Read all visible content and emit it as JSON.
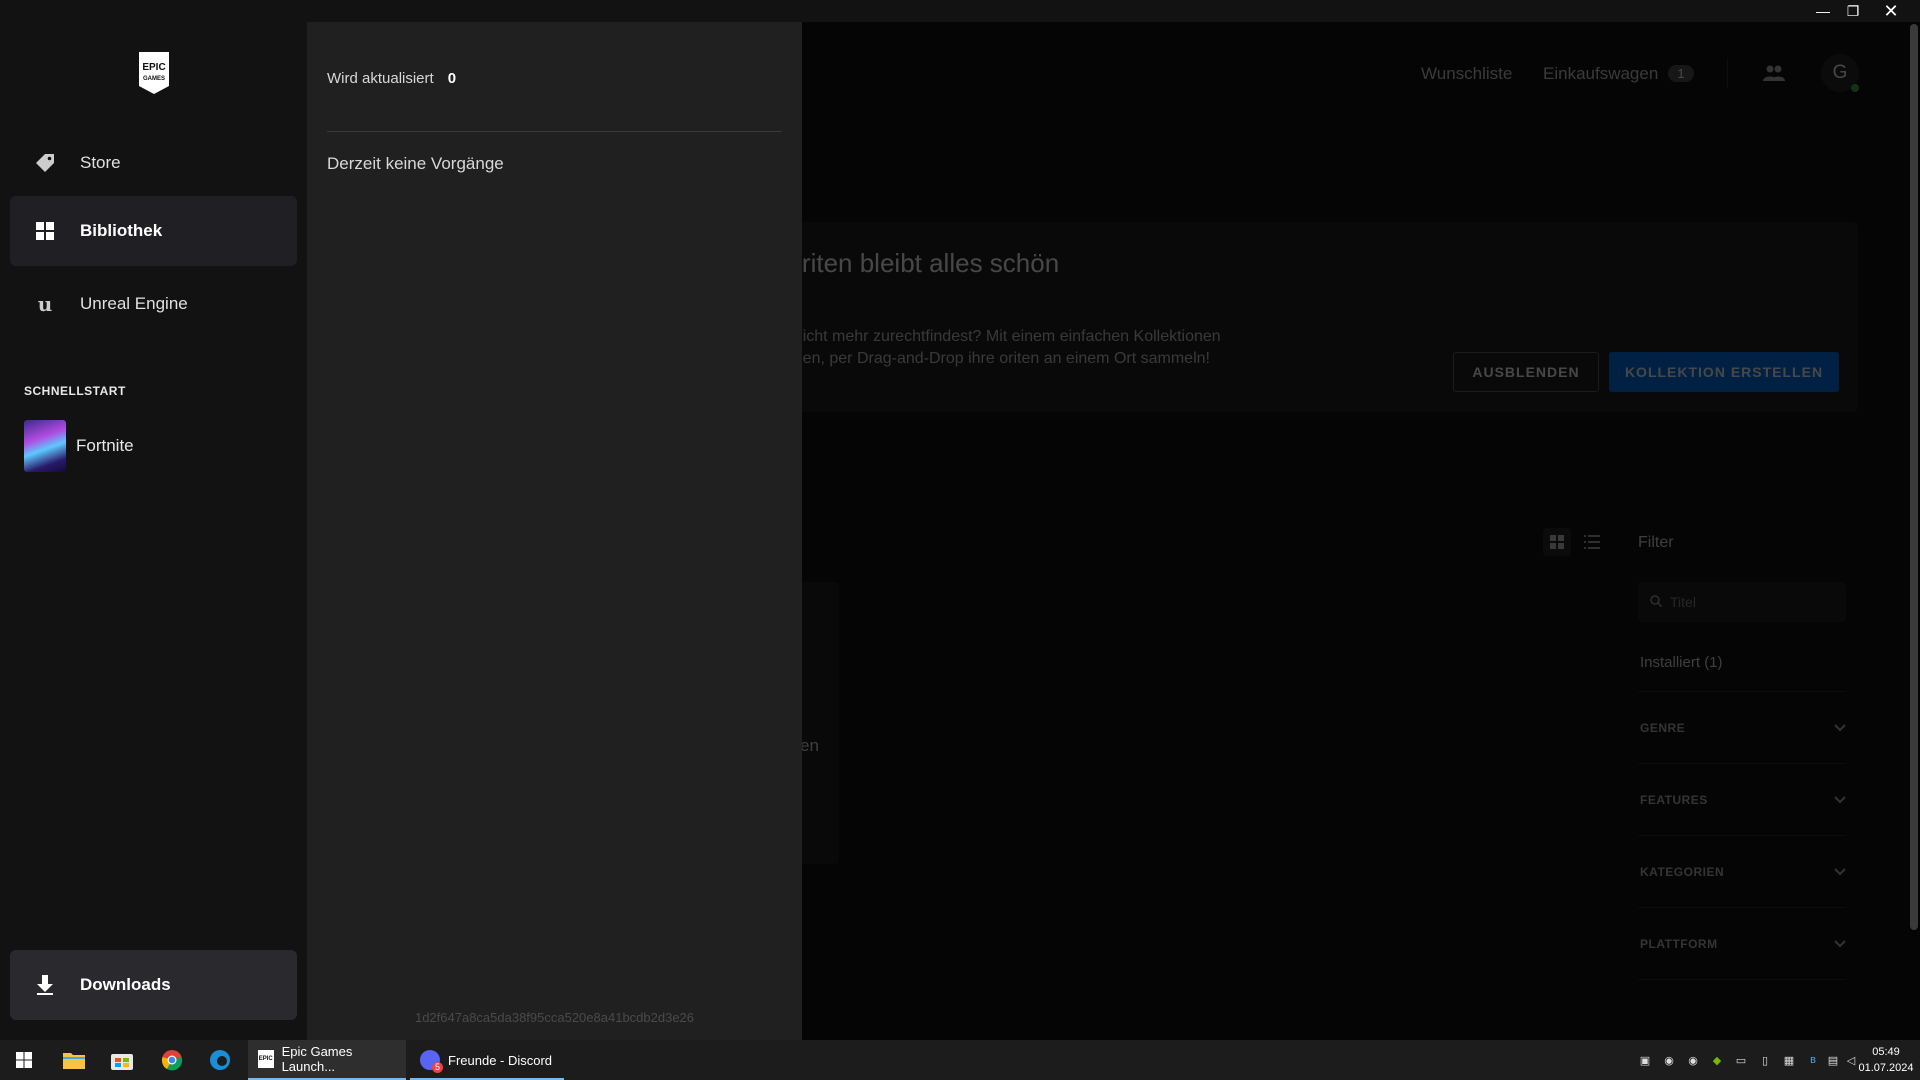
{
  "window": {
    "minimize": "—",
    "maximize": "❐",
    "close": "✕"
  },
  "sidebar": {
    "logo_text": "EPIC GAMES",
    "nav": [
      {
        "label": "Store",
        "icon": "tag-icon"
      },
      {
        "label": "Bibliothek",
        "icon": "grid-icon",
        "active": true
      },
      {
        "label": "Unreal Engine",
        "icon": "unreal-icon"
      }
    ],
    "quickstart_title": "SCHNELLSTART",
    "quickstart": [
      {
        "label": "Fortnite"
      }
    ],
    "downloads_label": "Downloads"
  },
  "header": {
    "wishlist": "Wunschliste",
    "cart": "Einkaufswagen",
    "cart_count": "1",
    "avatar_initial": "G"
  },
  "banner": {
    "title": "avoriten bleibt alles schön",
    "text": "dich nicht mehr zurechtfindest? Mit einem einfachen Kollektionen erstellen, per Drag-and-Drop ihre oriten an einem Ort sammeln!",
    "hide_button": "AUSBLENDEN",
    "create_button": "KOLLEKTION ERSTELLEN"
  },
  "library": {
    "card_text_fragment": "en"
  },
  "filters": {
    "title": "Filter",
    "search_placeholder": "Titel",
    "installed": "Installiert (1)",
    "groups": [
      "GENRE",
      "FEATURES",
      "KATEGORIEN",
      "PLATTFORM"
    ]
  },
  "downloads_panel": {
    "updating_label": "Wird aktualisiert",
    "updating_count": "0",
    "empty_text": "Derzeit keine Vorgänge",
    "build_hash": "1d2f647a8ca5da38f95cca520e8a41bcdb2d3e26"
  },
  "taskbar": {
    "apps": [
      {
        "label": "Epic Games Launch...",
        "active": true
      },
      {
        "label": "Freunde - Discord",
        "badge": "5"
      }
    ],
    "clock_time": "05:49",
    "clock_date": "01.07.2024"
  },
  "colors": {
    "accent": "#0078f2",
    "sidebar_bg": "#121212",
    "panel_bg": "#202020",
    "taskbar_bg": "#1c1c1c"
  }
}
